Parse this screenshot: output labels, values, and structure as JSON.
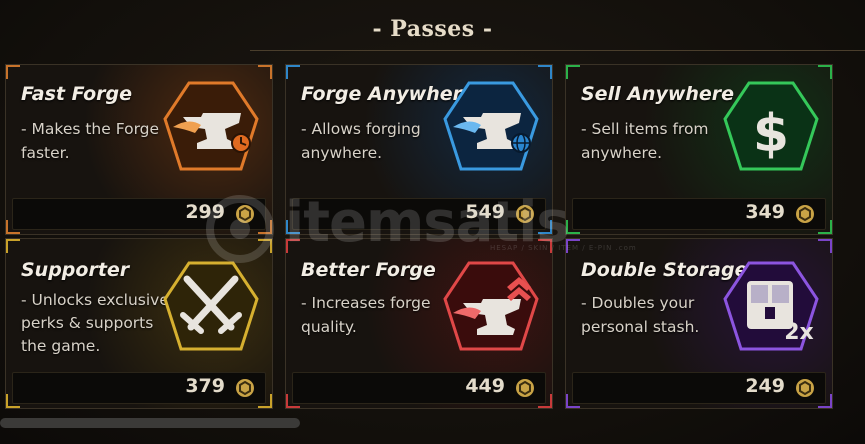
{
  "header": {
    "title": "- Passes -"
  },
  "passes": [
    {
      "name": "Fast Forge",
      "description": "- Makes the Forge faster.",
      "price": "299",
      "accent": "#c8732b",
      "icon": "anvil-clock-icon"
    },
    {
      "name": "Forge Anywhere",
      "description": "- Allows forging anywhere.",
      "price": "549",
      "accent": "#2f86c8",
      "icon": "anvil-globe-icon"
    },
    {
      "name": "Sell Anywhere",
      "description": "- Sell items from anywhere.",
      "price": "349",
      "accent": "#2bb14a",
      "icon": "dollar-icon"
    },
    {
      "name": "Supporter",
      "description": "- Unlocks exclusive perks & supports the game.",
      "price": "379",
      "accent": "#c9a22a",
      "icon": "crossed-swords-icon"
    },
    {
      "name": "Better Forge",
      "description": "- Increases forge quality.",
      "price": "449",
      "accent": "#c83a3a",
      "icon": "anvil-upgrade-icon"
    },
    {
      "name": "Double Storage",
      "description": "- Doubles your personal stash.",
      "price": "249",
      "accent": "#7a44c8",
      "icon": "storage-2x-icon"
    }
  ],
  "watermark": {
    "text": "itemsatis",
    "sub": "HESAP / SKIN / ITEM / E-PIN .com"
  }
}
